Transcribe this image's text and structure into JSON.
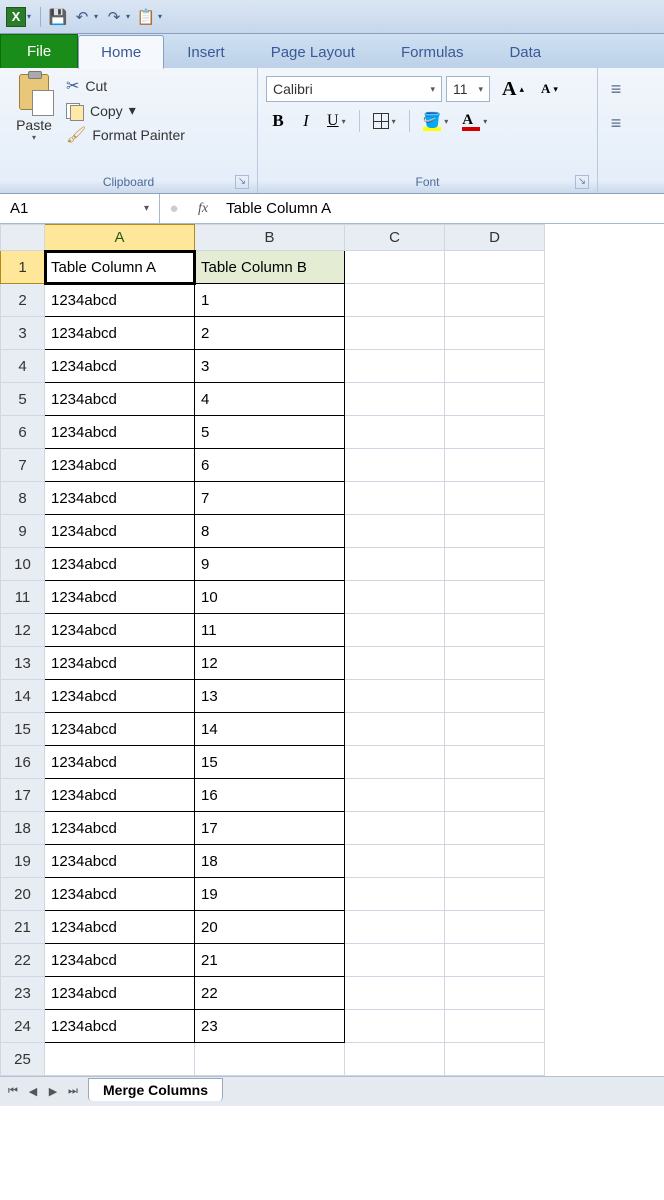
{
  "qat": {
    "app_letter": "X"
  },
  "tabs": {
    "file": "File",
    "home": "Home",
    "insert": "Insert",
    "pagelayout": "Page Layout",
    "formulas": "Formulas",
    "data": "Data"
  },
  "ribbon": {
    "clipboard": {
      "paste": "Paste",
      "cut": "Cut",
      "copy": "Copy",
      "format_painter": "Format Painter",
      "group_label": "Clipboard"
    },
    "font": {
      "font_name": "Calibri",
      "font_size": "11",
      "bold": "B",
      "italic": "I",
      "underline": "U",
      "fontcolor_letter": "A",
      "grow": "A",
      "shrink": "A",
      "group_label": "Font"
    }
  },
  "namebox": "A1",
  "formula_label": "fx",
  "formula_value": "Table Column A",
  "columns": [
    "A",
    "B",
    "C",
    "D"
  ],
  "col_widths": [
    "colA",
    "colB",
    "colC",
    "colD"
  ],
  "rows": [
    1,
    2,
    3,
    4,
    5,
    6,
    7,
    8,
    9,
    10,
    11,
    12,
    13,
    14,
    15,
    16,
    17,
    18,
    19,
    20,
    21,
    22,
    23,
    24,
    25
  ],
  "chart_data": {
    "type": "table",
    "headers": [
      "Table Column A",
      "Table Column B"
    ],
    "data": [
      [
        "1234abcd",
        "1"
      ],
      [
        "1234abcd",
        "2"
      ],
      [
        "1234abcd",
        "3"
      ],
      [
        "1234abcd",
        "4"
      ],
      [
        "1234abcd",
        "5"
      ],
      [
        "1234abcd",
        "6"
      ],
      [
        "1234abcd",
        "7"
      ],
      [
        "1234abcd",
        "8"
      ],
      [
        "1234abcd",
        "9"
      ],
      [
        "1234abcd",
        "10"
      ],
      [
        "1234abcd",
        "11"
      ],
      [
        "1234abcd",
        "12"
      ],
      [
        "1234abcd",
        "13"
      ],
      [
        "1234abcd",
        "14"
      ],
      [
        "1234abcd",
        "15"
      ],
      [
        "1234abcd",
        "16"
      ],
      [
        "1234abcd",
        "17"
      ],
      [
        "1234abcd",
        "18"
      ],
      [
        "1234abcd",
        "19"
      ],
      [
        "1234abcd",
        "20"
      ],
      [
        "1234abcd",
        "21"
      ],
      [
        "1234abcd",
        "22"
      ],
      [
        "1234abcd",
        "23"
      ]
    ]
  },
  "sheet_tab": "Merge Columns"
}
